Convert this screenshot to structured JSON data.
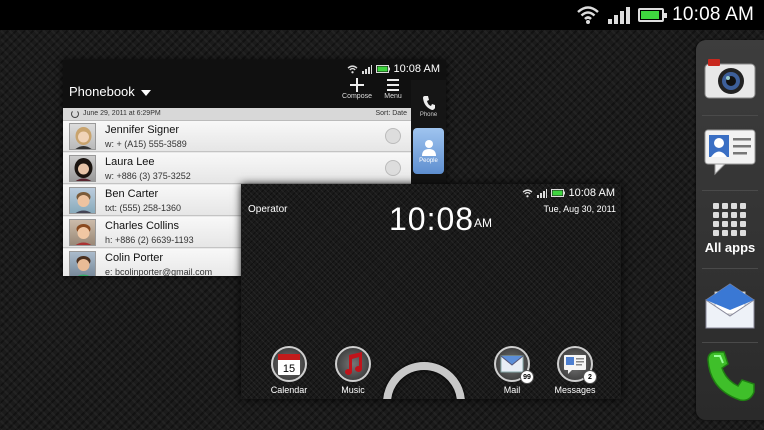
{
  "status_bar": {
    "time": "10:08 AM",
    "battery_level": 0.9,
    "wifi_icon": "wifi-icon",
    "signal_icon": "signal-icon"
  },
  "dock": {
    "items": [
      {
        "name": "camera",
        "icon": "camera-icon",
        "label": ""
      },
      {
        "name": "people",
        "icon": "contact-card-icon",
        "label": ""
      },
      {
        "name": "all-apps",
        "icon": "grid-icon",
        "label": "All apps"
      },
      {
        "name": "mail",
        "icon": "envelope-icon",
        "label": ""
      },
      {
        "name": "phone",
        "icon": "phone-icon",
        "label": ""
      }
    ]
  },
  "phonebook": {
    "status_time": "10:08 AM",
    "title": "Phonebook",
    "toolbar": {
      "compose_label": "Compose",
      "menu_label": "Menu"
    },
    "tabs": [
      {
        "label": "Phone",
        "icon": "phone-handset-icon",
        "active": false
      },
      {
        "label": "People",
        "icon": "person-icon",
        "active": true
      }
    ],
    "sync_date": "June 29, 2011 at 6:29PM",
    "sort_label": "Sort: Date",
    "contacts": [
      {
        "name": "Jennifer Signer",
        "detail": "w: + (A15) 555-3589"
      },
      {
        "name": "Laura Lee",
        "detail": "w: +886 (3) 375-3252"
      },
      {
        "name": "Ben Carter",
        "detail": "txt: (555) 258-1360"
      },
      {
        "name": "Charles Collins",
        "detail": "h: +886 (2) 6639-1193"
      },
      {
        "name": "Colin Porter",
        "detail": "e: bcolinporter@gmail.com"
      }
    ]
  },
  "home_preview": {
    "status_time": "10:08 AM",
    "operator": "Operator",
    "clock": "10:08",
    "ampm": "AM",
    "date": "Tue, Aug 30, 2011",
    "apps": [
      {
        "label": "Calendar",
        "icon": "calendar-icon",
        "badge": "",
        "calendar_day": "15"
      },
      {
        "label": "Music",
        "icon": "music-note-icon",
        "badge": ""
      },
      {
        "label": "Mail",
        "icon": "mail-icon",
        "badge": "99"
      },
      {
        "label": "Messages",
        "icon": "messages-icon",
        "badge": "2"
      }
    ]
  },
  "colors": {
    "accent": "#5f8fd0",
    "battery": "#3fd43f",
    "music": "#c0141b"
  }
}
